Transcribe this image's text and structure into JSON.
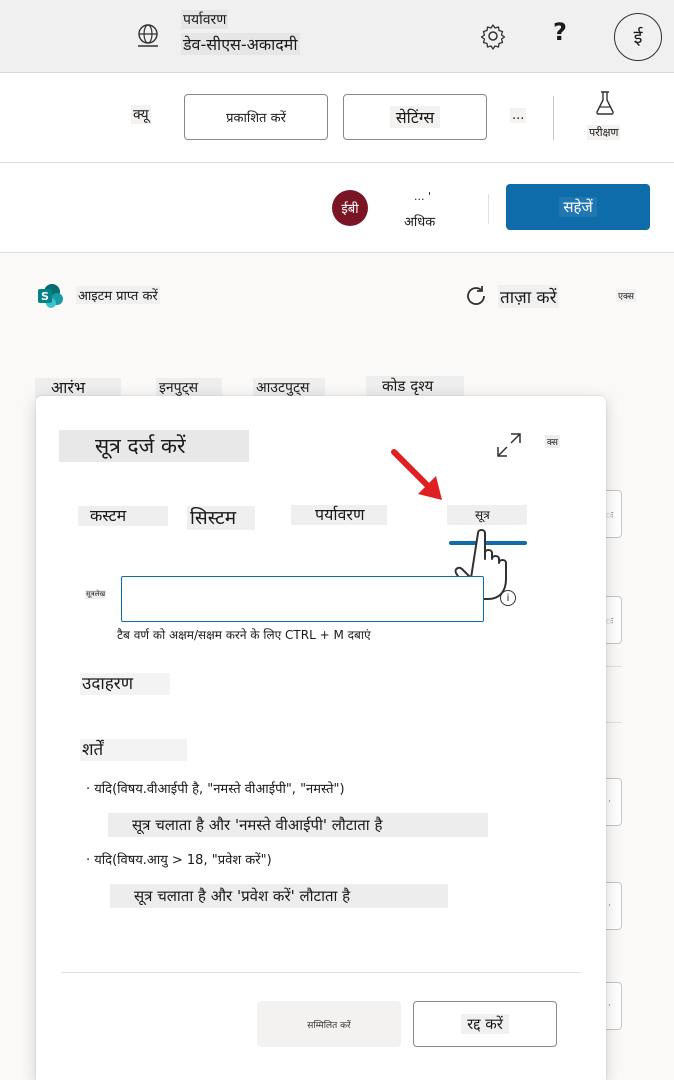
{
  "header": {
    "environment_label": "पर्यावरण",
    "environment_name": "डेव-सीएस-अकादमी",
    "help_glyph": "?",
    "avatar_initial": "ई",
    "icons": [
      "globe-icon",
      "gear-icon",
      "help-icon"
    ]
  },
  "command_bar": {
    "queue_label": "क्यू",
    "publish_label": "प्रकाशित करें",
    "settings_label": "सेटिंग्स",
    "more_label": "...",
    "test_label": "परीक्षण"
  },
  "save_bar": {
    "avatar_initials": "ईबी",
    "avatar_color": "#7a1526",
    "more_dots": "... '",
    "more_label": "अधिक",
    "save_label": "सहेजें",
    "save_color": "#0f6cab"
  },
  "actions": {
    "get_items_label": "आइटम प्राप्त करें",
    "refresh_label": "ताज़ा करें",
    "expand_label": "एक्स"
  },
  "background_tabs": [
    "आरंभ",
    "इनपुट्स",
    "आउटपुट्स",
    "कोड दृश्य"
  ],
  "dialog": {
    "title": "सूत्र दर्ज करें",
    "close_label": "क्स",
    "tabs": [
      {
        "label": "कस्टम",
        "selected": false
      },
      {
        "label": "सिस्टम",
        "selected": false
      },
      {
        "label": "पर्यावरण",
        "selected": false
      },
      {
        "label": "सूत्र",
        "selected": true
      }
    ],
    "input_label": "सूत्रलेख",
    "input_value": "",
    "info_glyph": "i",
    "hint": "टैब वर्ण को अक्षम/सक्षम करने के लिए CTRL + M दबाएं",
    "examples_heading": "उदाहरण",
    "conditions_heading": "शर्तें",
    "examples": [
      {
        "code": "· यदि(विषय.वीआईपी है, \"नमस्ते वीआईपी\", \"नमस्ते\")",
        "description": "सूत्र चलाता है और 'नमस्ते वीआईपी' लौटाता है"
      },
      {
        "code": "· यदि(विषय.आयु > 18, \"प्रवेश करें\")",
        "description": "सूत्र चलाता है और 'प्रवेश करें' लौटाता है"
      }
    ],
    "insert_label": "सम्मिलित करें",
    "cancel_label": "रद्द करें",
    "accent_color": "#0f6cab",
    "arrow_color": "#e02020"
  },
  "side_stubs": [
    "ः",
    "ः",
    "·",
    "·",
    "·"
  ]
}
